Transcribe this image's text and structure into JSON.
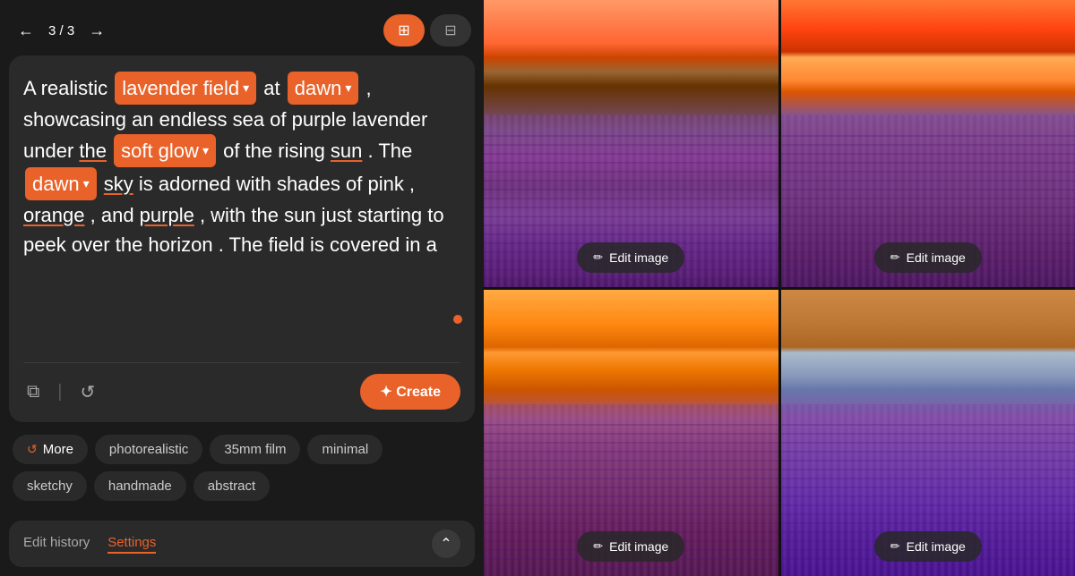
{
  "nav": {
    "back_arrow": "←",
    "forward_arrow": "→",
    "counter": "3 / 3",
    "grid_icon_active": "⊞",
    "grid_icon_inactive": "⊟"
  },
  "prompt": {
    "text_parts": [
      {
        "type": "text",
        "value": "A realistic "
      },
      {
        "type": "chip",
        "value": "lavender field ▾"
      },
      {
        "type": "text",
        "value": " at "
      },
      {
        "type": "chip",
        "value": "dawn ▾"
      },
      {
        "type": "text",
        "value": " , showcasing an endless sea of purple lavender under "
      },
      {
        "type": "underline",
        "value": "the"
      },
      {
        "type": "text",
        "value": " "
      },
      {
        "type": "chip",
        "value": "soft glow ▾"
      },
      {
        "type": "text",
        "value": " of the rising "
      },
      {
        "type": "underline",
        "value": "sun"
      },
      {
        "type": "text",
        "value": " . The "
      },
      {
        "type": "chip",
        "value": "dawn ▾"
      },
      {
        "type": "text",
        "value": " "
      },
      {
        "type": "underline",
        "value": "sky"
      },
      {
        "type": "text",
        "value": " is adorned with shades of pink , "
      },
      {
        "type": "underline",
        "value": "orange"
      },
      {
        "type": "text",
        "value": " , and "
      },
      {
        "type": "underline",
        "value": "purple"
      },
      {
        "type": "text",
        "value": " , with the sun just starting to peek over the horizon . The field is covered in a"
      }
    ],
    "copy_icon": "⧉",
    "refresh_icon": "↺",
    "create_label": "✦ Create"
  },
  "styles": {
    "more_label": "More",
    "chips": [
      "photorealistic",
      "35mm film",
      "minimal",
      "sketchy",
      "handmade",
      "abstract"
    ]
  },
  "tabs": {
    "edit_history": "Edit history",
    "settings": "Settings",
    "active": "settings",
    "chevron": "⌃"
  },
  "images": [
    {
      "id": 1,
      "edit_label": "Edit image"
    },
    {
      "id": 2,
      "edit_label": "Edit image"
    },
    {
      "id": 3,
      "edit_label": "Edit image"
    },
    {
      "id": 4,
      "edit_label": "Edit image"
    }
  ]
}
